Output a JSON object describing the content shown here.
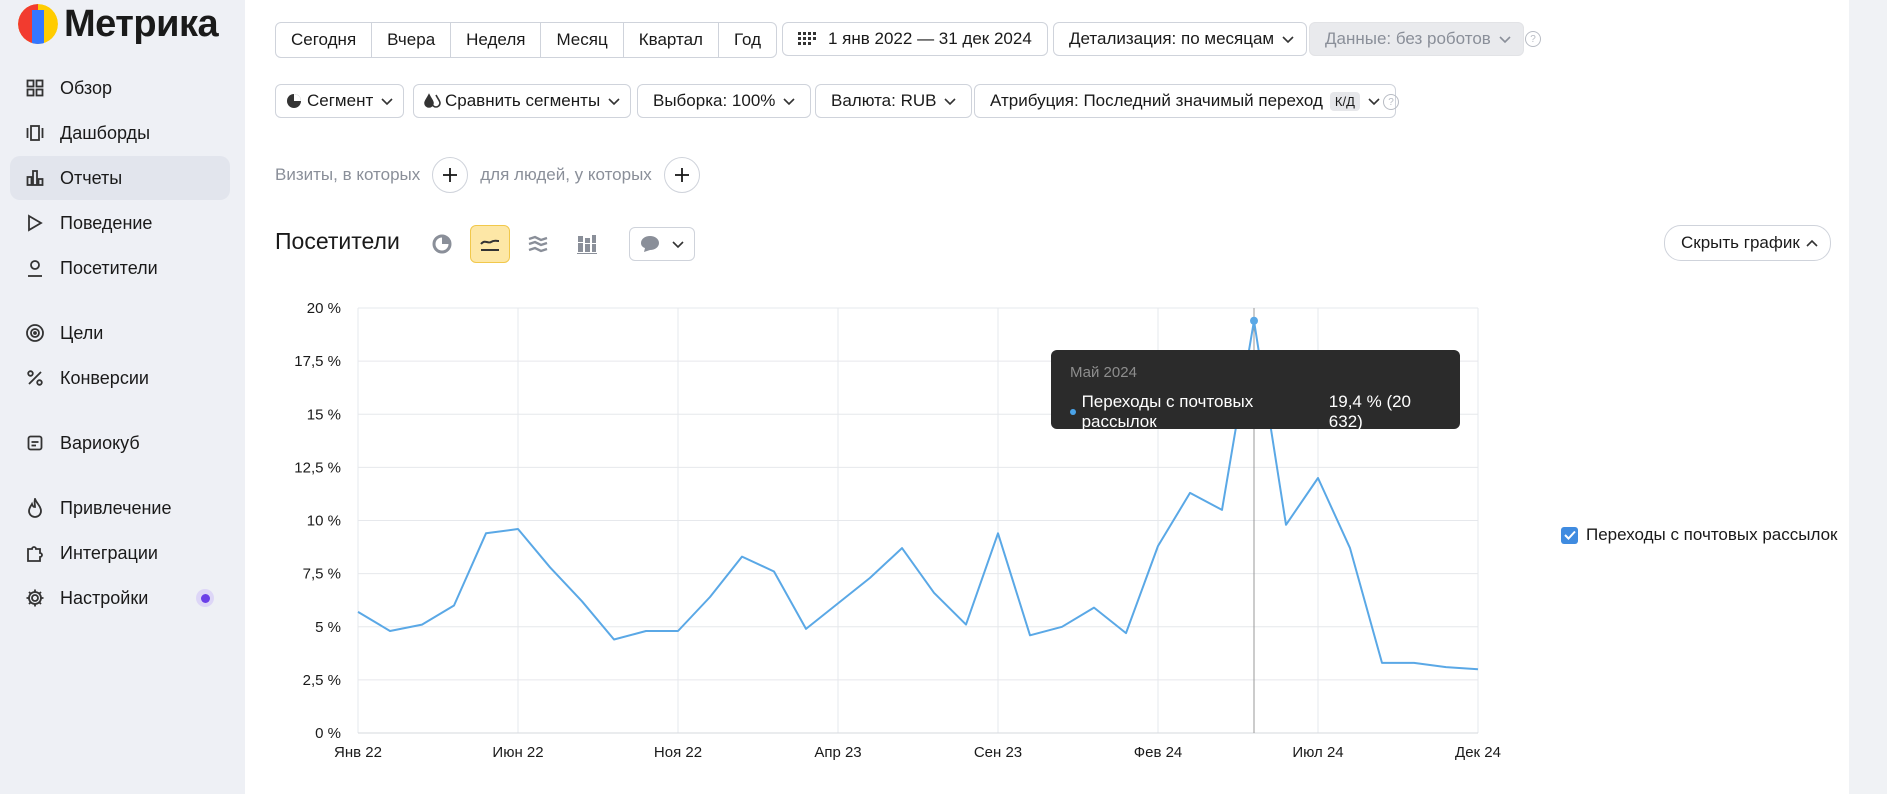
{
  "app": {
    "logo_text": "Метрика"
  },
  "sidebar": {
    "items": [
      {
        "label": "Обзор",
        "icon": "grid-icon"
      },
      {
        "label": "Дашборды",
        "icon": "dashboard-icon"
      },
      {
        "label": "Отчеты",
        "icon": "bar-chart-icon",
        "active": true
      },
      {
        "label": "Поведение",
        "icon": "play-icon"
      },
      {
        "label": "Посетители",
        "icon": "user-icon"
      },
      {
        "label": "Цели",
        "icon": "target-icon"
      },
      {
        "label": "Конверсии",
        "icon": "percent-icon"
      },
      {
        "label": "Вариокуб",
        "icon": "cube-icon"
      },
      {
        "label": "Привлечение",
        "icon": "flame-icon"
      },
      {
        "label": "Интеграции",
        "icon": "puzzle-icon"
      },
      {
        "label": "Настройки",
        "icon": "gear-icon"
      }
    ]
  },
  "toolbar": {
    "periods": [
      "Сегодня",
      "Вчера",
      "Неделя",
      "Месяц",
      "Квартал",
      "Год"
    ],
    "date_range": "1 янв 2022 — 31 дек 2024",
    "detail": "Детализация: по месяцам",
    "data_filter": "Данные: без роботов",
    "segment": "Сегмент",
    "compare": "Сравнить сегменты",
    "sample": "Выборка: 100%",
    "currency": "Валюта: RUB",
    "attribution": "Атрибуция: Последний значимый переход",
    "attribution_badge": "К/Д",
    "help": "?"
  },
  "filters": {
    "visits_label": "Визиты, в которых",
    "people_label": "для людей, у которых"
  },
  "chart_section": {
    "title": "Посетители",
    "hide_label": "Скрыть график"
  },
  "tooltip": {
    "month": "Май 2024",
    "series": "Переходы с почтовых рассылок",
    "value": "19,4 % (20 632)"
  },
  "legend": {
    "label": "Переходы с почтовых рассылок"
  },
  "colors": {
    "line": "#5aa8e6",
    "accent": "#fde7a6",
    "checkbox": "#3f8be0"
  },
  "chart_data": {
    "type": "line",
    "x_tick_labels": [
      "Янв 22",
      "Июн 22",
      "Ноя 22",
      "Апр 23",
      "Сен 23",
      "Фев 24",
      "Июл 24",
      "Дек 24"
    ],
    "y_tick_labels": [
      "0 %",
      "2,5 %",
      "5 %",
      "7,5 %",
      "10 %",
      "12,5 %",
      "15 %",
      "17,5 %",
      "20 %"
    ],
    "ylim": [
      0,
      20
    ],
    "series": [
      {
        "name": "Переходы с почтовых рассылок",
        "values": [
          5.7,
          4.8,
          5.1,
          6.0,
          9.4,
          9.6,
          7.8,
          6.2,
          4.4,
          4.8,
          4.8,
          6.4,
          8.3,
          7.6,
          4.9,
          6.1,
          7.3,
          8.7,
          6.6,
          5.1,
          9.4,
          4.6,
          5.0,
          5.9,
          4.7,
          8.8,
          11.3,
          10.5,
          19.4,
          9.8,
          12.0,
          8.7,
          3.3,
          3.3,
          3.1,
          3.0
        ]
      }
    ],
    "highlight_index": 28,
    "grid": true
  }
}
